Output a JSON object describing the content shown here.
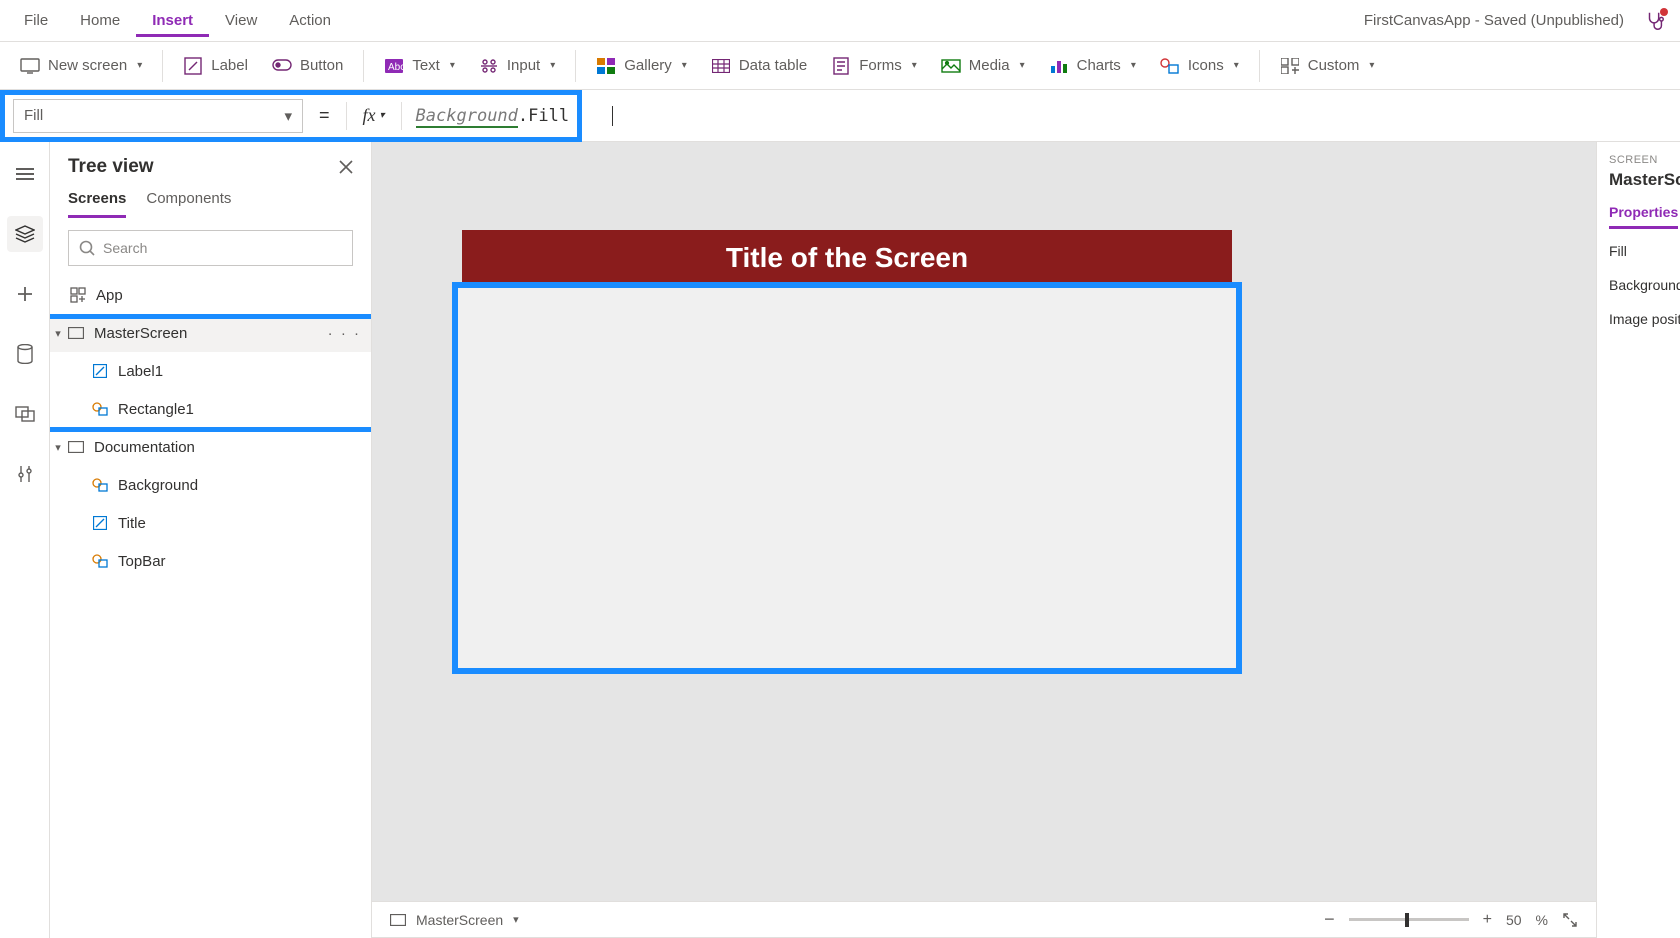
{
  "menu": {
    "items": [
      "File",
      "Home",
      "Insert",
      "View",
      "Action"
    ],
    "active": "Insert"
  },
  "app_title": "FirstCanvasApp - Saved (Unpublished)",
  "ribbon": {
    "new_screen": "New screen",
    "label": "Label",
    "button": "Button",
    "text": "Text",
    "input": "Input",
    "gallery": "Gallery",
    "data_table": "Data table",
    "forms": "Forms",
    "media": "Media",
    "charts": "Charts",
    "icons": "Icons",
    "custom": "Custom"
  },
  "formula": {
    "property": "Fill",
    "equals": "=",
    "fx": "fx",
    "ref": "Background",
    "dot_prop": ".Fill"
  },
  "tree": {
    "title": "Tree view",
    "tabs": {
      "screens": "Screens",
      "components": "Components"
    },
    "search_placeholder": "Search",
    "app": "App",
    "master": "MasterScreen",
    "label1": "Label1",
    "rect1": "Rectangle1",
    "doc": "Documentation",
    "background": "Background",
    "title_item": "Title",
    "topbar": "TopBar",
    "more": "· · ·"
  },
  "canvas": {
    "title": "Title of the Screen",
    "status_screen": "MasterScreen",
    "zoom_value": "50",
    "zoom_pct": "%"
  },
  "props": {
    "section": "SCREEN",
    "name": "MasterScreen",
    "tab": "Properties",
    "fill": "Fill",
    "bg": "Background",
    "imgpos": "Image position"
  }
}
